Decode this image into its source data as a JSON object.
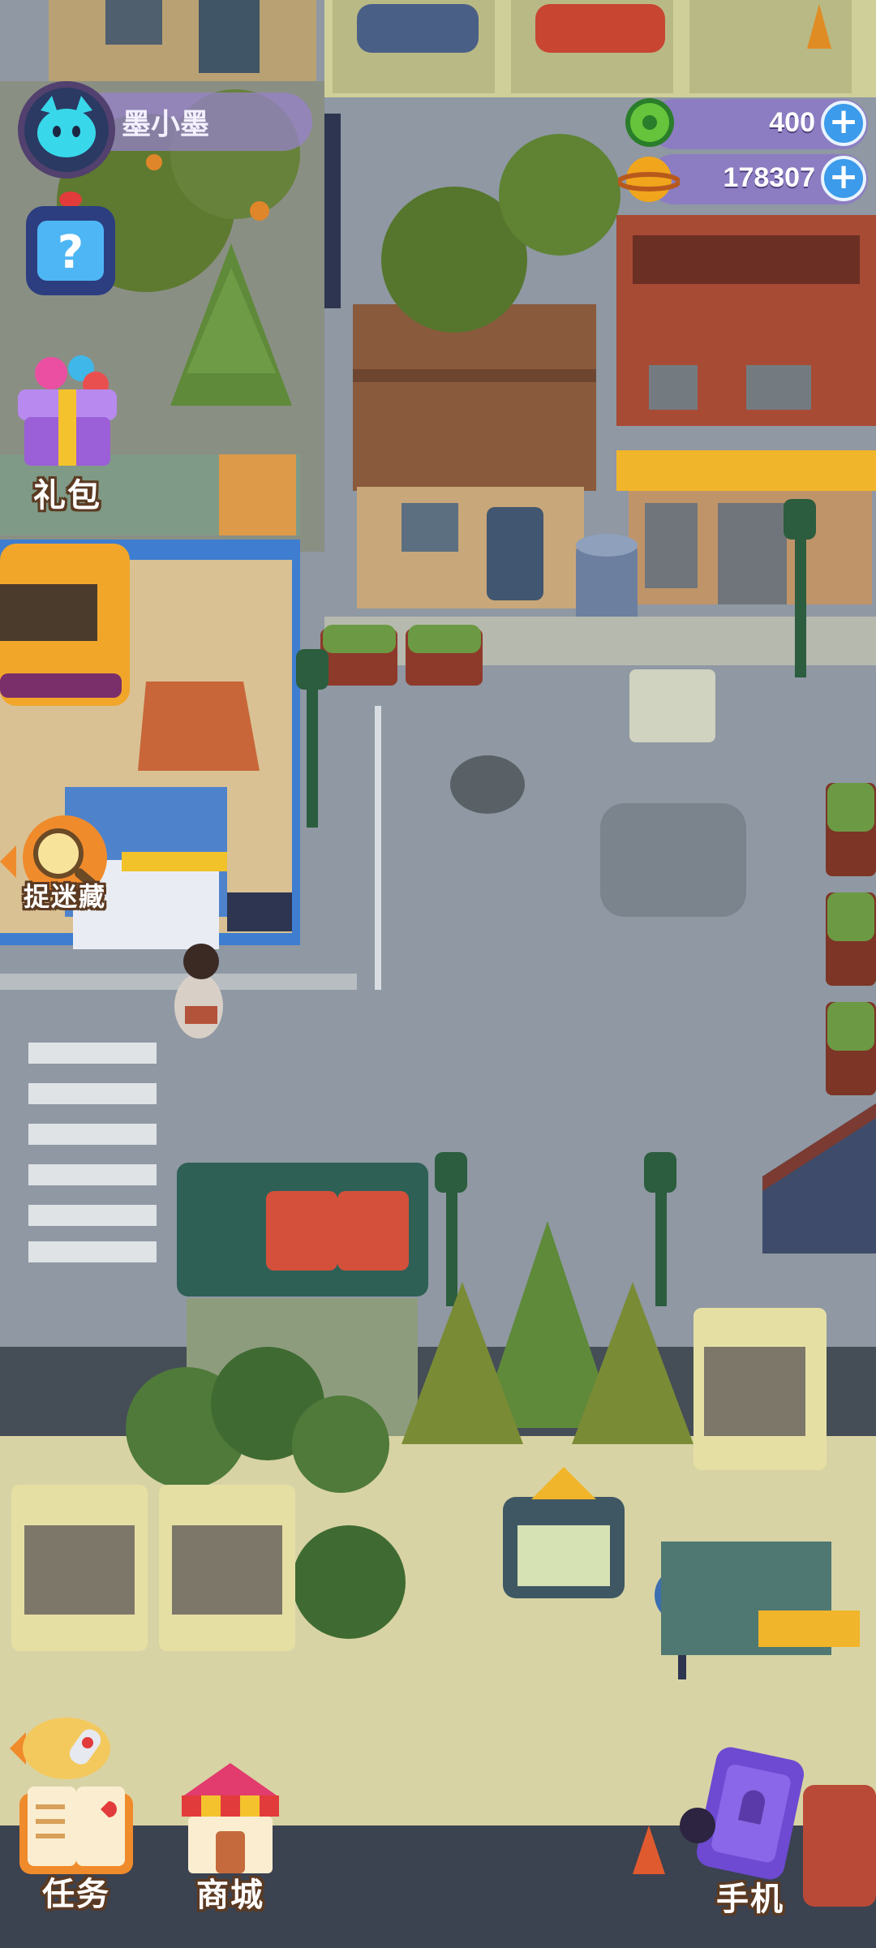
{
  "player": {
    "name": "墨小墨"
  },
  "currencies": {
    "gems": {
      "value": "400",
      "icon": "green-donut-gem-icon"
    },
    "coins": {
      "value": "178307",
      "icon": "gold-planet-coin-icon"
    }
  },
  "left_menu": {
    "help_icon": "question-tv-icon",
    "gift_label": "礼包",
    "hide_and_seek_label": "捉迷藏"
  },
  "bottom_menu": {
    "tasks_label": "任务",
    "shop_label": "商城",
    "phone_label": "手机"
  },
  "colors": {
    "road": "#8f98a3",
    "sidewalk": "#a9b0b6",
    "grass_area": "#d8d3a4",
    "tree_green": "#6f8a3a",
    "accent_purple": "#8c78c8",
    "accent_blue": "#3c9bea"
  }
}
